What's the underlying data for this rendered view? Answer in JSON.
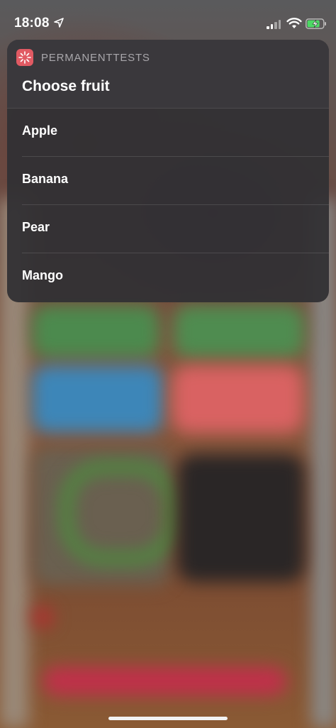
{
  "status_bar": {
    "time": "18:08",
    "icons": [
      "location-arrow-icon",
      "cellular-signal-icon",
      "wifi-icon",
      "battery-charging-icon"
    ]
  },
  "notification": {
    "app_name": "PERMANENTTESTS",
    "app_icon": "shortcuts-sparkle-icon",
    "title": "Choose fruit",
    "options": [
      {
        "label": "Apple"
      },
      {
        "label": "Banana"
      },
      {
        "label": "Pear"
      },
      {
        "label": "Mango"
      }
    ]
  },
  "colors": {
    "card_bg": "#323034",
    "app_icon_bg": "#e15a63",
    "battery_green": "#4cd964"
  }
}
